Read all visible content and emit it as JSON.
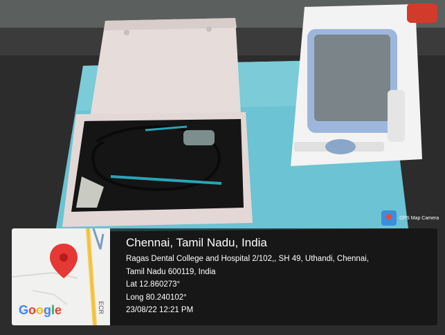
{
  "badge": {
    "label": "GPS Map Camera",
    "icon": "gps-map-camera-icon"
  },
  "location": {
    "city": "Chennai, Tamil Nadu, India",
    "address_line1": "Ragas Dental College and Hospital 2/102,, SH 49, Uthandi, Chennai,",
    "address_line2": "Tamil Nadu 600119, India",
    "lat": "Lat 12.860273°",
    "long": "Long 80.240102°",
    "datetime": "23/08/22 12:21 PM"
  },
  "map": {
    "road_label": "ECR",
    "provider": "Google",
    "pin_color": "#e53935"
  },
  "colors": {
    "drape": "#73c6d4",
    "device_screen": "#9bb5d8",
    "box": "#e9e2df"
  }
}
